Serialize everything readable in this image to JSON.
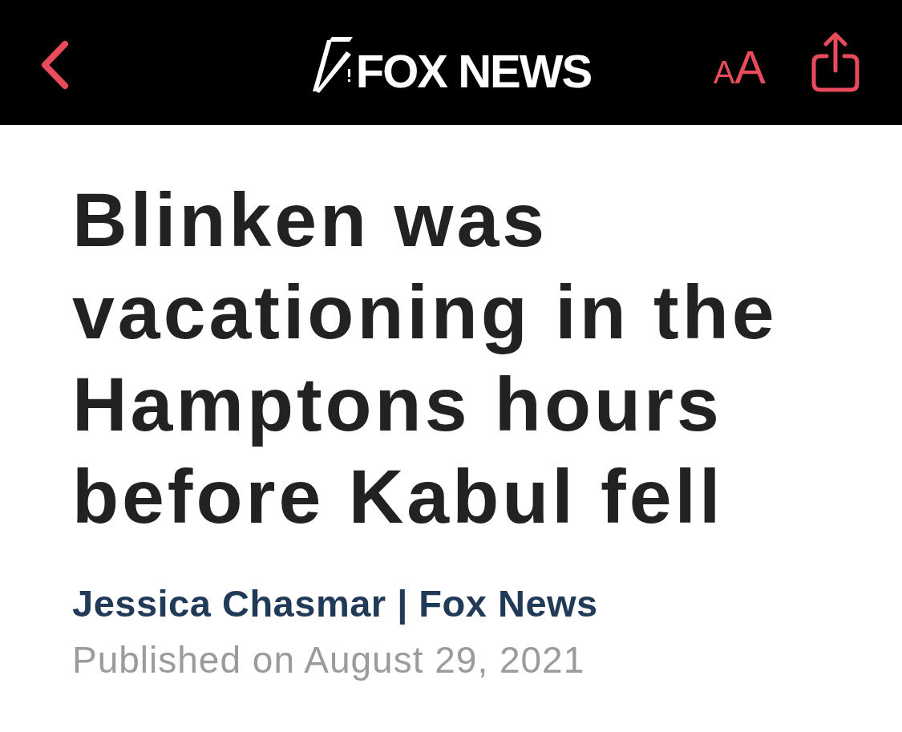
{
  "header": {
    "logo": {
      "text": "FOX NEWS"
    },
    "text_size_button": {
      "glyphs": [
        "A",
        "A"
      ]
    }
  },
  "article": {
    "headline": "Blinken was vacationing in the Hamptons hours before Kabul fell",
    "byline": "Jessica Chasmar | Fox News",
    "published": "Published on August 29, 2021"
  }
}
